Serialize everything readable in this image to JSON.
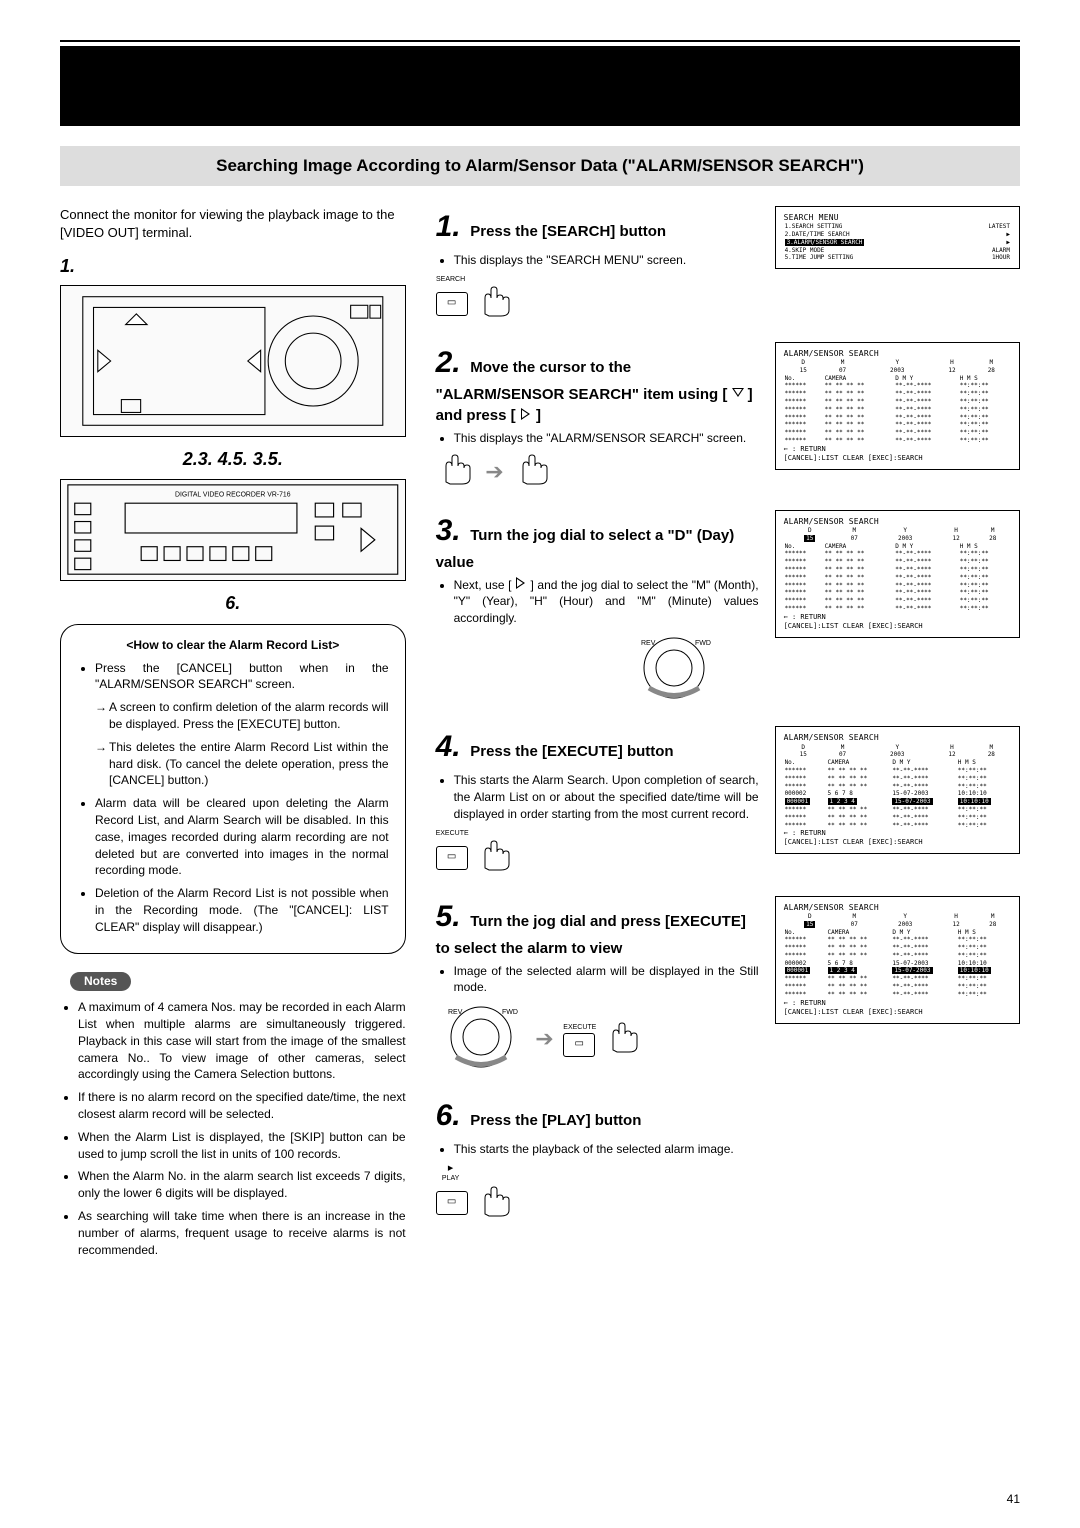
{
  "page_number": "41",
  "section_title": "Searching Image According to Alarm/Sensor Data (\"ALARM/SENSOR SEARCH\")",
  "intro": "Connect the monitor for viewing the playback image to the [VIDEO OUT] terminal.",
  "left": {
    "label1": "1.",
    "label2": "2.3. 4.5. 3.5.",
    "label6": "6.",
    "panel_caption": "DIGITAL VIDEO RECORDER VR-716",
    "howto_title": "<How to clear the Alarm Record List>",
    "howto_items": [
      "Press the [CANCEL] button when in the \"ALARM/SENSOR SEARCH\" screen.",
      "A screen to confirm deletion of the alarm records will be displayed. Press the [EXECUTE] button.",
      "This deletes the entire Alarm Record List within the hard disk. (To cancel the delete operation, press the [CANCEL] button.)",
      "Alarm data will be cleared upon deleting the Alarm Record List, and Alarm Search will be disabled. In this case, images recorded during alarm recording are not deleted but are converted into images in the normal recording mode.",
      "Deletion of the Alarm Record List is not possible when in the Recording mode. (The \"[CANCEL]: LIST CLEAR\" display will disappear.)"
    ],
    "notes_label": "Notes",
    "notes": [
      "A maximum of 4 camera Nos. may be recorded in each Alarm List when multiple alarms are simultaneously triggered. Playback in this case will start from the image of the smallest camera No.. To view image of other cameras, select accordingly using the Camera Selection buttons.",
      "If there is no alarm record on the specified date/time, the next closest alarm record will be selected.",
      "When the Alarm List is displayed, the [SKIP] button can be used to jump scroll the list in units of 100 records.",
      "When the Alarm No. in the alarm search list exceeds 7 digits, only the lower 6 digits will be displayed.",
      "As searching will take time when there is an increase in the number of alarms, frequent usage to receive alarms is not recommended."
    ]
  },
  "steps": [
    {
      "num": "1.",
      "title": "Press the [SEARCH] button",
      "body": "This displays the \"SEARCH MENU\" screen.",
      "btn": "SEARCH"
    },
    {
      "num": "2.",
      "title": "Move the cursor to the \"ALARM/SENSOR SEARCH\" item using [ ▽ ] and press [ ▷ ]",
      "body": "This displays the \"ALARM/SENSOR SEARCH\" screen."
    },
    {
      "num": "3.",
      "title": "Turn the jog dial to select a \"D\" (Day) value",
      "body": "Next, use [ ▷ ] and the jog dial to select the \"M\" (Month), \"Y\" (Year), \"H\" (Hour) and \"M\" (Minute) values accordingly."
    },
    {
      "num": "4.",
      "title": "Press the [EXECUTE] button",
      "body": "This starts the Alarm Search. Upon completion of search, the Alarm List on or about the specified date/time will be displayed in order starting from the most current record.",
      "btn": "EXECUTE"
    },
    {
      "num": "5.",
      "title": "Turn the jog dial and press [EXECUTE] to select the alarm to view",
      "body": "Image of the selected alarm will be displayed in the Still mode.",
      "btn": "EXECUTE"
    },
    {
      "num": "6.",
      "title": "Press the [PLAY] button",
      "body": "This starts the playback of the selected alarm image.",
      "btn": "PLAY"
    }
  ],
  "screens": {
    "menu": {
      "title": "SEARCH MENU",
      "items": [
        [
          "1.SEARCH SETTING",
          "LATEST"
        ],
        [
          "2.DATE/TIME SEARCH",
          "▶"
        ],
        [
          "3.ALARM/SENSOR SEARCH",
          "▶"
        ],
        [
          "4.SKIP MODE",
          "ALARM"
        ],
        [
          "5.TIME JUMP SETTING",
          "1HOUR"
        ]
      ]
    },
    "alarm": {
      "title": "ALARM/SENSOR SEARCH",
      "hdr": [
        "D",
        "M",
        "Y",
        "H",
        "M"
      ],
      "vals": [
        "15",
        "07",
        "2003",
        "12",
        "28"
      ],
      "sub": [
        "No.",
        "CAMERA",
        "D  M  Y",
        "H  M  S"
      ],
      "rows": [
        [
          "******",
          "** ** ** **",
          "**-**-****",
          "**:**:**"
        ],
        [
          "******",
          "** ** ** **",
          "**-**-****",
          "**:**:**"
        ],
        [
          "******",
          "** ** ** **",
          "**-**-****",
          "**:**:**"
        ],
        [
          "******",
          "** ** ** **",
          "**-**-****",
          "**:**:**"
        ],
        [
          "******",
          "** ** ** **",
          "**-**-****",
          "**:**:**"
        ],
        [
          "******",
          "** ** ** **",
          "**-**-****",
          "**:**:**"
        ],
        [
          "******",
          "** ** ** **",
          "**-**-****",
          "**:**:**"
        ],
        [
          "******",
          "** ** ** **",
          "**-**-****",
          "**:**:**"
        ]
      ],
      "ret": "⇐ : RETURN",
      "foot": "[CANCEL]:LIST CLEAR [EXEC]:SEARCH"
    },
    "alarm4": {
      "rows": [
        [
          "******",
          "** ** ** **",
          "**-**-****",
          "**:**:**"
        ],
        [
          "******",
          "** ** ** **",
          "**-**-****",
          "**:**:**"
        ],
        [
          "******",
          "** ** ** **",
          "**-**-****",
          "**:**:**"
        ],
        [
          "000002",
          "5  6  7  8",
          "15-07-2003",
          "10:10:10"
        ],
        [
          "000001",
          "1  2  3  4",
          "15-07-2003",
          "10:10:10"
        ],
        [
          "******",
          "** ** ** **",
          "**-**-****",
          "**:**:**"
        ],
        [
          "******",
          "** ** ** **",
          "**-**-****",
          "**:**:**"
        ],
        [
          "******",
          "** ** ** **",
          "**-**-****",
          "**:**:**"
        ]
      ]
    }
  }
}
